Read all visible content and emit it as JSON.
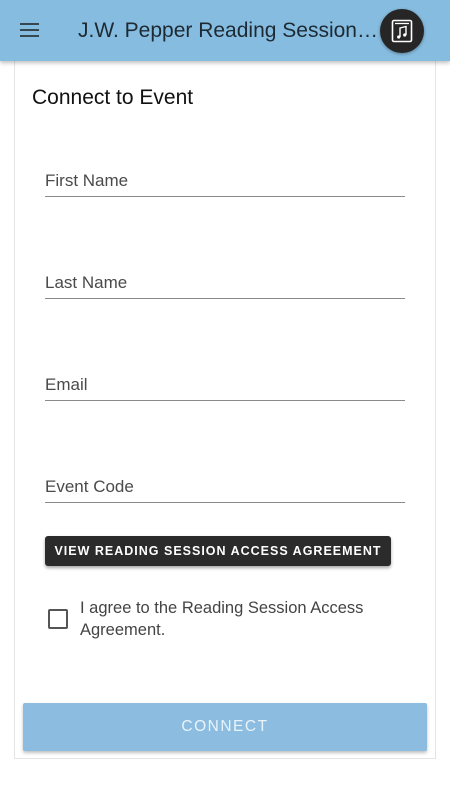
{
  "app_bar": {
    "title": "J.W. Pepper Reading Session Tool",
    "menu_icon": "hamburger-menu-icon",
    "logo_icon": "music-book-icon",
    "background": "#86bcdf"
  },
  "form": {
    "title": "Connect to Event",
    "fields": {
      "first_name": {
        "placeholder": "First Name",
        "value": ""
      },
      "last_name": {
        "placeholder": "Last Name",
        "value": ""
      },
      "email": {
        "placeholder": "Email",
        "value": ""
      },
      "event_code": {
        "placeholder": "Event Code",
        "value": ""
      }
    },
    "view_agreement_label": "VIEW READING SESSION ACCESS AGREEMENT",
    "agree_checkbox": {
      "label": "I agree to the Reading Session Access Agreement.",
      "checked": false
    },
    "connect_label": "CONNECT"
  },
  "colors": {
    "accent": "#86bcdf",
    "connect_button": "#8cbde0",
    "dark_button": "#2b2b2b"
  }
}
